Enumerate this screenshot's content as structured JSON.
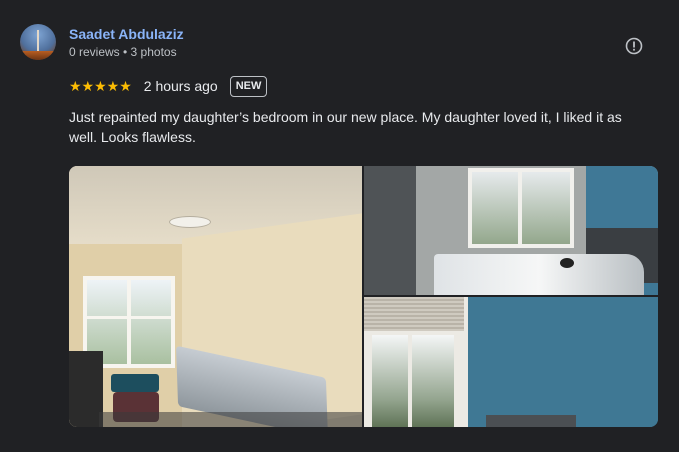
{
  "reviewer": {
    "name": "Saadet Abdulaziz",
    "meta": "0 reviews • 3 photos"
  },
  "review": {
    "stars": "★★★★★",
    "rating": 5,
    "time": "2 hours ago",
    "badge": "NEW",
    "text": "Just repainted my daughter’s bedroom in our new place. My daughter loved it, I liked it as well. Looks flawless."
  },
  "icons": {
    "report": "report-icon"
  },
  "colors": {
    "background": "#202124",
    "name": "#8ab4f8",
    "star": "#fbbc04",
    "text": "#e8eaed",
    "muted": "#bdc1c6"
  },
  "photos": [
    {
      "subject": "bedroom with beige walls, window and mattress"
    },
    {
      "subject": "blue wall with bed and window"
    },
    {
      "subject": "blue wall with window blinds"
    }
  ]
}
